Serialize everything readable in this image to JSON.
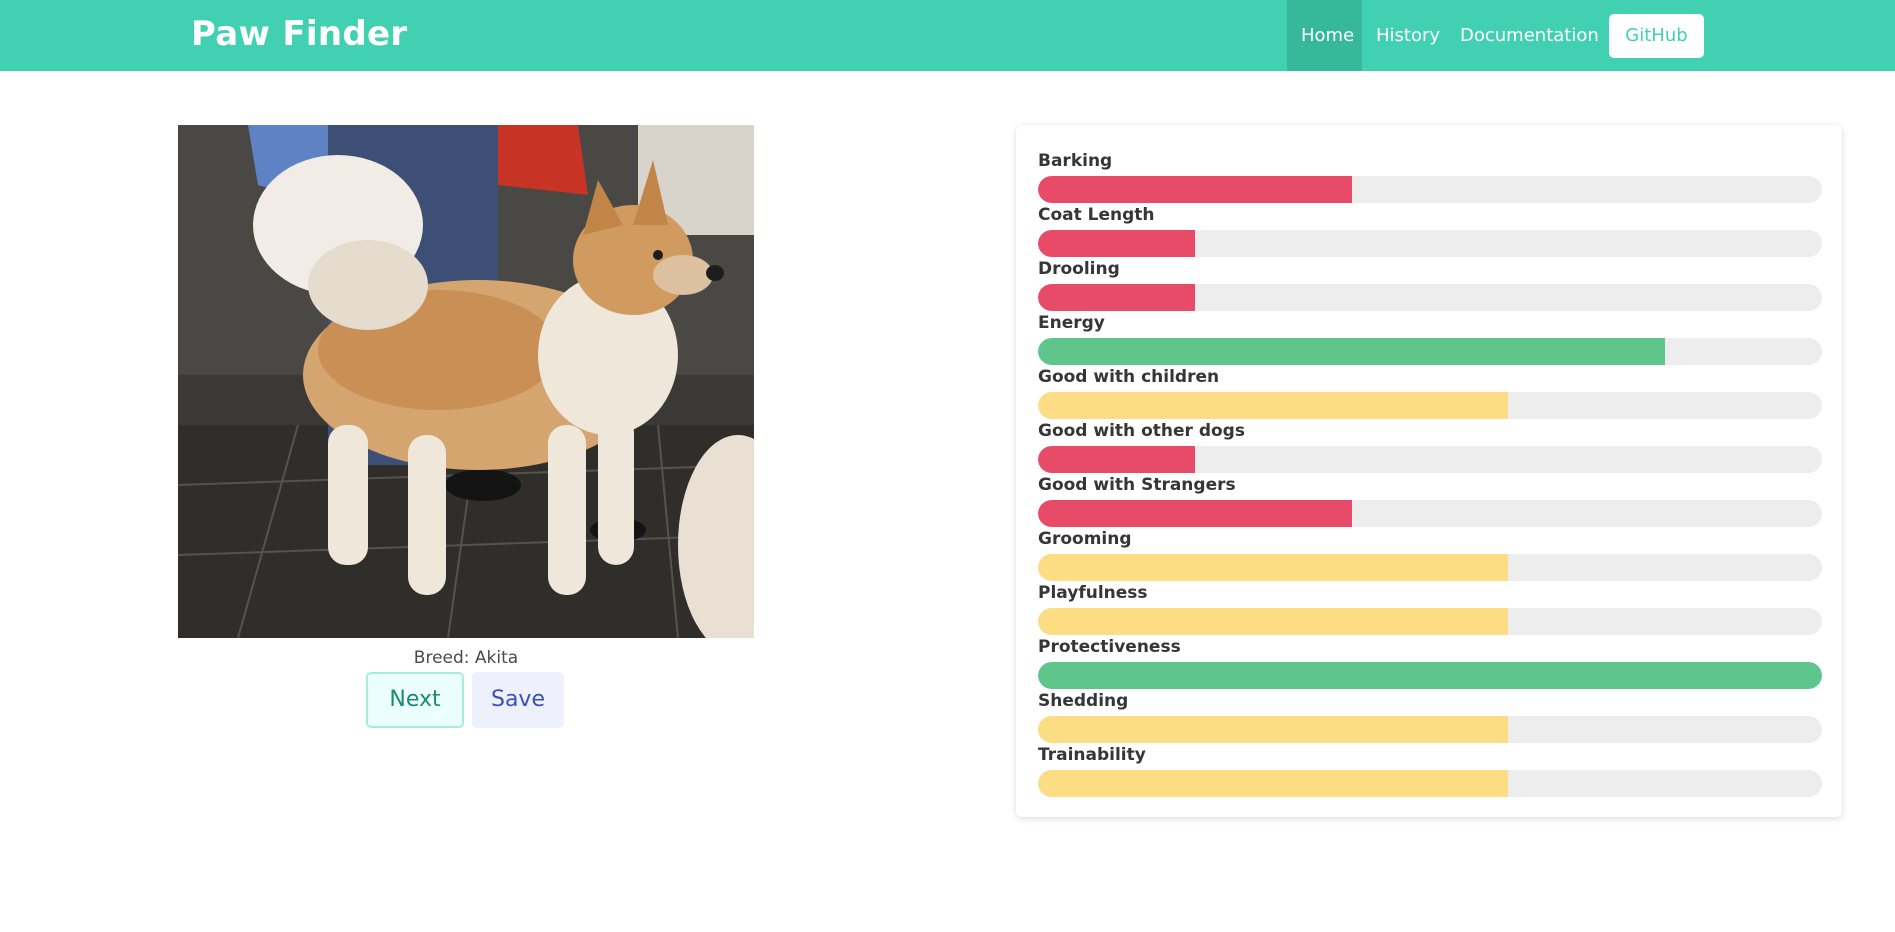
{
  "app": {
    "brand": "Paw Finder"
  },
  "nav": {
    "items": [
      {
        "label": "Home",
        "active": true
      },
      {
        "label": "History",
        "active": false
      },
      {
        "label": "Documentation",
        "active": false
      }
    ],
    "github_label": "GitHub"
  },
  "dog": {
    "breed_text": "Breed: Akita",
    "next_label": "Next",
    "save_label": "Save"
  },
  "colors": {
    "accent": "#41d0b2",
    "low": "#e84b67",
    "mid": "#fddd84",
    "high": "#5fc68b",
    "track": "#ededed"
  },
  "traits": [
    {
      "label": "Barking",
      "level": 0.4,
      "status": "low"
    },
    {
      "label": "Coat Length",
      "level": 0.2,
      "status": "low"
    },
    {
      "label": "Drooling",
      "level": 0.2,
      "status": "low"
    },
    {
      "label": "Energy",
      "level": 0.8,
      "status": "high"
    },
    {
      "label": "Good with children",
      "level": 0.6,
      "status": "mid"
    },
    {
      "label": "Good with other dogs",
      "level": 0.2,
      "status": "low"
    },
    {
      "label": "Good with Strangers",
      "level": 0.4,
      "status": "low"
    },
    {
      "label": "Grooming",
      "level": 0.6,
      "status": "mid"
    },
    {
      "label": "Playfulness",
      "level": 0.6,
      "status": "mid"
    },
    {
      "label": "Protectiveness",
      "level": 1.0,
      "status": "high"
    },
    {
      "label": "Shedding",
      "level": 0.6,
      "status": "mid"
    },
    {
      "label": "Trainability",
      "level": 0.6,
      "status": "mid"
    }
  ]
}
